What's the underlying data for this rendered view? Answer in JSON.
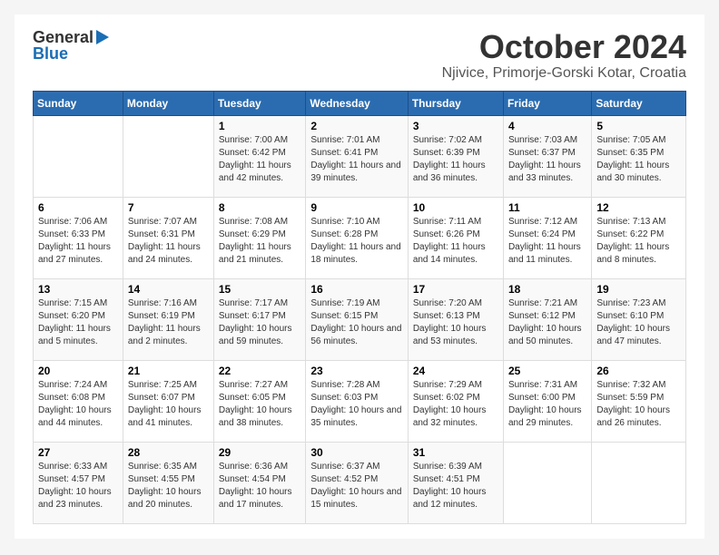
{
  "header": {
    "logo_general": "General",
    "logo_blue": "Blue",
    "title": "October 2024",
    "location": "Njivice, Primorje-Gorski Kotar, Croatia"
  },
  "weekdays": [
    "Sunday",
    "Monday",
    "Tuesday",
    "Wednesday",
    "Thursday",
    "Friday",
    "Saturday"
  ],
  "weeks": [
    [
      {
        "day": "",
        "sunrise": "",
        "sunset": "",
        "daylight": ""
      },
      {
        "day": "",
        "sunrise": "",
        "sunset": "",
        "daylight": ""
      },
      {
        "day": "1",
        "sunrise": "Sunrise: 7:00 AM",
        "sunset": "Sunset: 6:42 PM",
        "daylight": "Daylight: 11 hours and 42 minutes."
      },
      {
        "day": "2",
        "sunrise": "Sunrise: 7:01 AM",
        "sunset": "Sunset: 6:41 PM",
        "daylight": "Daylight: 11 hours and 39 minutes."
      },
      {
        "day": "3",
        "sunrise": "Sunrise: 7:02 AM",
        "sunset": "Sunset: 6:39 PM",
        "daylight": "Daylight: 11 hours and 36 minutes."
      },
      {
        "day": "4",
        "sunrise": "Sunrise: 7:03 AM",
        "sunset": "Sunset: 6:37 PM",
        "daylight": "Daylight: 11 hours and 33 minutes."
      },
      {
        "day": "5",
        "sunrise": "Sunrise: 7:05 AM",
        "sunset": "Sunset: 6:35 PM",
        "daylight": "Daylight: 11 hours and 30 minutes."
      }
    ],
    [
      {
        "day": "6",
        "sunrise": "Sunrise: 7:06 AM",
        "sunset": "Sunset: 6:33 PM",
        "daylight": "Daylight: 11 hours and 27 minutes."
      },
      {
        "day": "7",
        "sunrise": "Sunrise: 7:07 AM",
        "sunset": "Sunset: 6:31 PM",
        "daylight": "Daylight: 11 hours and 24 minutes."
      },
      {
        "day": "8",
        "sunrise": "Sunrise: 7:08 AM",
        "sunset": "Sunset: 6:29 PM",
        "daylight": "Daylight: 11 hours and 21 minutes."
      },
      {
        "day": "9",
        "sunrise": "Sunrise: 7:10 AM",
        "sunset": "Sunset: 6:28 PM",
        "daylight": "Daylight: 11 hours and 18 minutes."
      },
      {
        "day": "10",
        "sunrise": "Sunrise: 7:11 AM",
        "sunset": "Sunset: 6:26 PM",
        "daylight": "Daylight: 11 hours and 14 minutes."
      },
      {
        "day": "11",
        "sunrise": "Sunrise: 7:12 AM",
        "sunset": "Sunset: 6:24 PM",
        "daylight": "Daylight: 11 hours and 11 minutes."
      },
      {
        "day": "12",
        "sunrise": "Sunrise: 7:13 AM",
        "sunset": "Sunset: 6:22 PM",
        "daylight": "Daylight: 11 hours and 8 minutes."
      }
    ],
    [
      {
        "day": "13",
        "sunrise": "Sunrise: 7:15 AM",
        "sunset": "Sunset: 6:20 PM",
        "daylight": "Daylight: 11 hours and 5 minutes."
      },
      {
        "day": "14",
        "sunrise": "Sunrise: 7:16 AM",
        "sunset": "Sunset: 6:19 PM",
        "daylight": "Daylight: 11 hours and 2 minutes."
      },
      {
        "day": "15",
        "sunrise": "Sunrise: 7:17 AM",
        "sunset": "Sunset: 6:17 PM",
        "daylight": "Daylight: 10 hours and 59 minutes."
      },
      {
        "day": "16",
        "sunrise": "Sunrise: 7:19 AM",
        "sunset": "Sunset: 6:15 PM",
        "daylight": "Daylight: 10 hours and 56 minutes."
      },
      {
        "day": "17",
        "sunrise": "Sunrise: 7:20 AM",
        "sunset": "Sunset: 6:13 PM",
        "daylight": "Daylight: 10 hours and 53 minutes."
      },
      {
        "day": "18",
        "sunrise": "Sunrise: 7:21 AM",
        "sunset": "Sunset: 6:12 PM",
        "daylight": "Daylight: 10 hours and 50 minutes."
      },
      {
        "day": "19",
        "sunrise": "Sunrise: 7:23 AM",
        "sunset": "Sunset: 6:10 PM",
        "daylight": "Daylight: 10 hours and 47 minutes."
      }
    ],
    [
      {
        "day": "20",
        "sunrise": "Sunrise: 7:24 AM",
        "sunset": "Sunset: 6:08 PM",
        "daylight": "Daylight: 10 hours and 44 minutes."
      },
      {
        "day": "21",
        "sunrise": "Sunrise: 7:25 AM",
        "sunset": "Sunset: 6:07 PM",
        "daylight": "Daylight: 10 hours and 41 minutes."
      },
      {
        "day": "22",
        "sunrise": "Sunrise: 7:27 AM",
        "sunset": "Sunset: 6:05 PM",
        "daylight": "Daylight: 10 hours and 38 minutes."
      },
      {
        "day": "23",
        "sunrise": "Sunrise: 7:28 AM",
        "sunset": "Sunset: 6:03 PM",
        "daylight": "Daylight: 10 hours and 35 minutes."
      },
      {
        "day": "24",
        "sunrise": "Sunrise: 7:29 AM",
        "sunset": "Sunset: 6:02 PM",
        "daylight": "Daylight: 10 hours and 32 minutes."
      },
      {
        "day": "25",
        "sunrise": "Sunrise: 7:31 AM",
        "sunset": "Sunset: 6:00 PM",
        "daylight": "Daylight: 10 hours and 29 minutes."
      },
      {
        "day": "26",
        "sunrise": "Sunrise: 7:32 AM",
        "sunset": "Sunset: 5:59 PM",
        "daylight": "Daylight: 10 hours and 26 minutes."
      }
    ],
    [
      {
        "day": "27",
        "sunrise": "Sunrise: 6:33 AM",
        "sunset": "Sunset: 4:57 PM",
        "daylight": "Daylight: 10 hours and 23 minutes."
      },
      {
        "day": "28",
        "sunrise": "Sunrise: 6:35 AM",
        "sunset": "Sunset: 4:55 PM",
        "daylight": "Daylight: 10 hours and 20 minutes."
      },
      {
        "day": "29",
        "sunrise": "Sunrise: 6:36 AM",
        "sunset": "Sunset: 4:54 PM",
        "daylight": "Daylight: 10 hours and 17 minutes."
      },
      {
        "day": "30",
        "sunrise": "Sunrise: 6:37 AM",
        "sunset": "Sunset: 4:52 PM",
        "daylight": "Daylight: 10 hours and 15 minutes."
      },
      {
        "day": "31",
        "sunrise": "Sunrise: 6:39 AM",
        "sunset": "Sunset: 4:51 PM",
        "daylight": "Daylight: 10 hours and 12 minutes."
      },
      {
        "day": "",
        "sunrise": "",
        "sunset": "",
        "daylight": ""
      },
      {
        "day": "",
        "sunrise": "",
        "sunset": "",
        "daylight": ""
      }
    ]
  ]
}
